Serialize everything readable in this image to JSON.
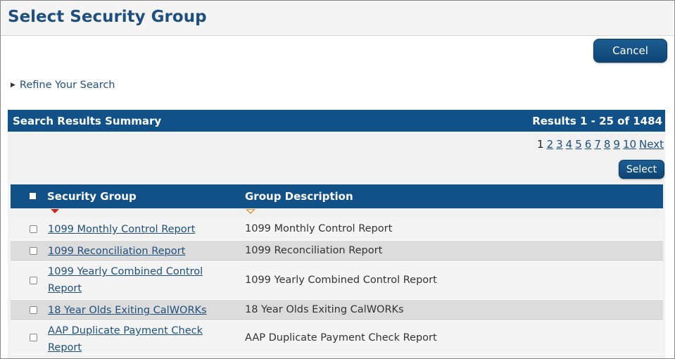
{
  "page": {
    "title": "Select Security Group"
  },
  "actions": {
    "cancel_label": "Cancel",
    "select_label": "Select"
  },
  "refine": {
    "label": "Refine Your Search"
  },
  "results": {
    "title": "Search Results Summary",
    "count": "Results 1 - 25 of 1484"
  },
  "pager": {
    "current": "1",
    "pages": [
      "2",
      "3",
      "4",
      "5",
      "6",
      "7",
      "8",
      "9",
      "10"
    ],
    "next_label": "Next"
  },
  "table": {
    "headers": {
      "security_group": "Security Group",
      "group_description": "Group Description"
    },
    "rows": [
      {
        "group": "1099 Monthly Control Report",
        "description": "1099 Monthly Control Report"
      },
      {
        "group": "1099 Reconciliation Report",
        "description": "1099 Reconciliation Report"
      },
      {
        "group": "1099 Yearly Combined Control Report",
        "description": "1099 Yearly Combined Control Report"
      },
      {
        "group": "18 Year Olds Exiting CalWORKs",
        "description": "18 Year Olds Exiting CalWORKs"
      },
      {
        "group": "AAP Duplicate Payment Check Report",
        "description": "AAP Duplicate Payment Check Report"
      }
    ]
  },
  "colors": {
    "header_blue": "#125188",
    "title_blue": "#1f4f7d",
    "sort_red": "#d0231c",
    "sort_orange": "#e8912b",
    "row_alt": "#dcdcdc"
  },
  "icons": {
    "refine_toggle": "triangle-right-icon",
    "sort_active": "sort-desc-icon",
    "sort_inactive": "sort-outline-icon"
  }
}
